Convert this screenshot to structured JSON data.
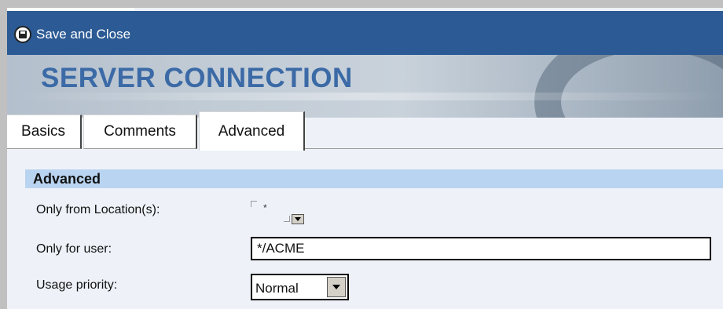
{
  "toolbar": {
    "save_close_label": "Save and Close",
    "save_icon": "floppy-disk-icon"
  },
  "banner": {
    "title": "SERVER CONNECTION"
  },
  "tabs": [
    {
      "label": "Basics",
      "active": false
    },
    {
      "label": "Comments",
      "active": false
    },
    {
      "label": "Advanced",
      "active": true
    }
  ],
  "section": {
    "title": "Advanced"
  },
  "fields": {
    "locations": {
      "label": "Only from Location(s):",
      "value": "*"
    },
    "user": {
      "label": "Only for user:",
      "value": "*/ACME"
    },
    "priority": {
      "label": "Usage priority:",
      "value": "Normal"
    }
  },
  "colors": {
    "action_bar": "#2b5a94",
    "banner_title": "#3b6aa6",
    "section_header": "#b9d4f0",
    "content_bg": "#eef2f8"
  }
}
